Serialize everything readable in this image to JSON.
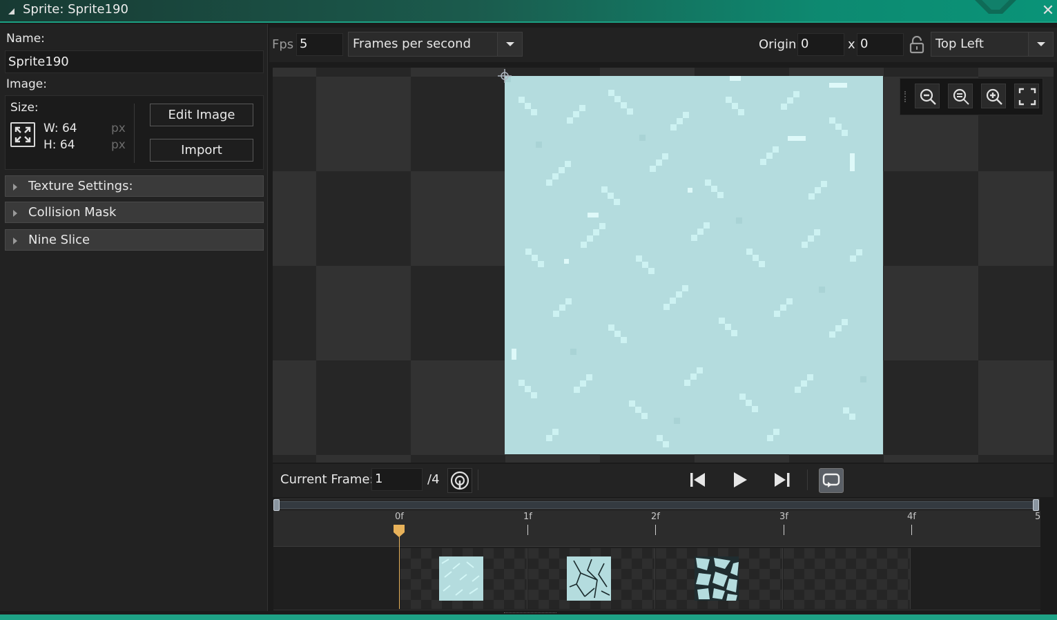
{
  "window": {
    "title": "Sprite: Sprite190",
    "close_glyph": "✕"
  },
  "left": {
    "name_label": "Name:",
    "name_value": "Sprite190",
    "image_label": "Image:",
    "size_label": "Size:",
    "width_label": "W: 64",
    "height_label": "H: 64",
    "px_unit": "px",
    "edit_image_label": "Edit Image",
    "import_label": "Import",
    "sections": [
      "Texture Settings:",
      "Collision Mask",
      "Nine Slice"
    ]
  },
  "toolbar": {
    "fps_label": "Fps",
    "fps_value": "5",
    "fps_mode": "Frames per second",
    "origin_label": "Origin",
    "origin_x": "0",
    "origin_sep": "x",
    "origin_y": "0",
    "origin_preset": "Top Left"
  },
  "zoom": {
    "icons": [
      "zoom-out-icon",
      "zoom-reset-icon",
      "zoom-in-icon",
      "fit-screen-icon"
    ]
  },
  "playback": {
    "current_frame_label": "Current Frame:",
    "current_frame_value": "1",
    "total_frames": "/4"
  },
  "timeline": {
    "ticks": [
      "0f",
      "1f",
      "2f",
      "3f",
      "4f",
      "5"
    ],
    "playhead_frame": 0
  },
  "colors": {
    "accent": "#1ba284",
    "sprite_base": "#b4dcde",
    "sprite_highlight": "#d2f6f6",
    "playhead": "#e8b25a"
  }
}
